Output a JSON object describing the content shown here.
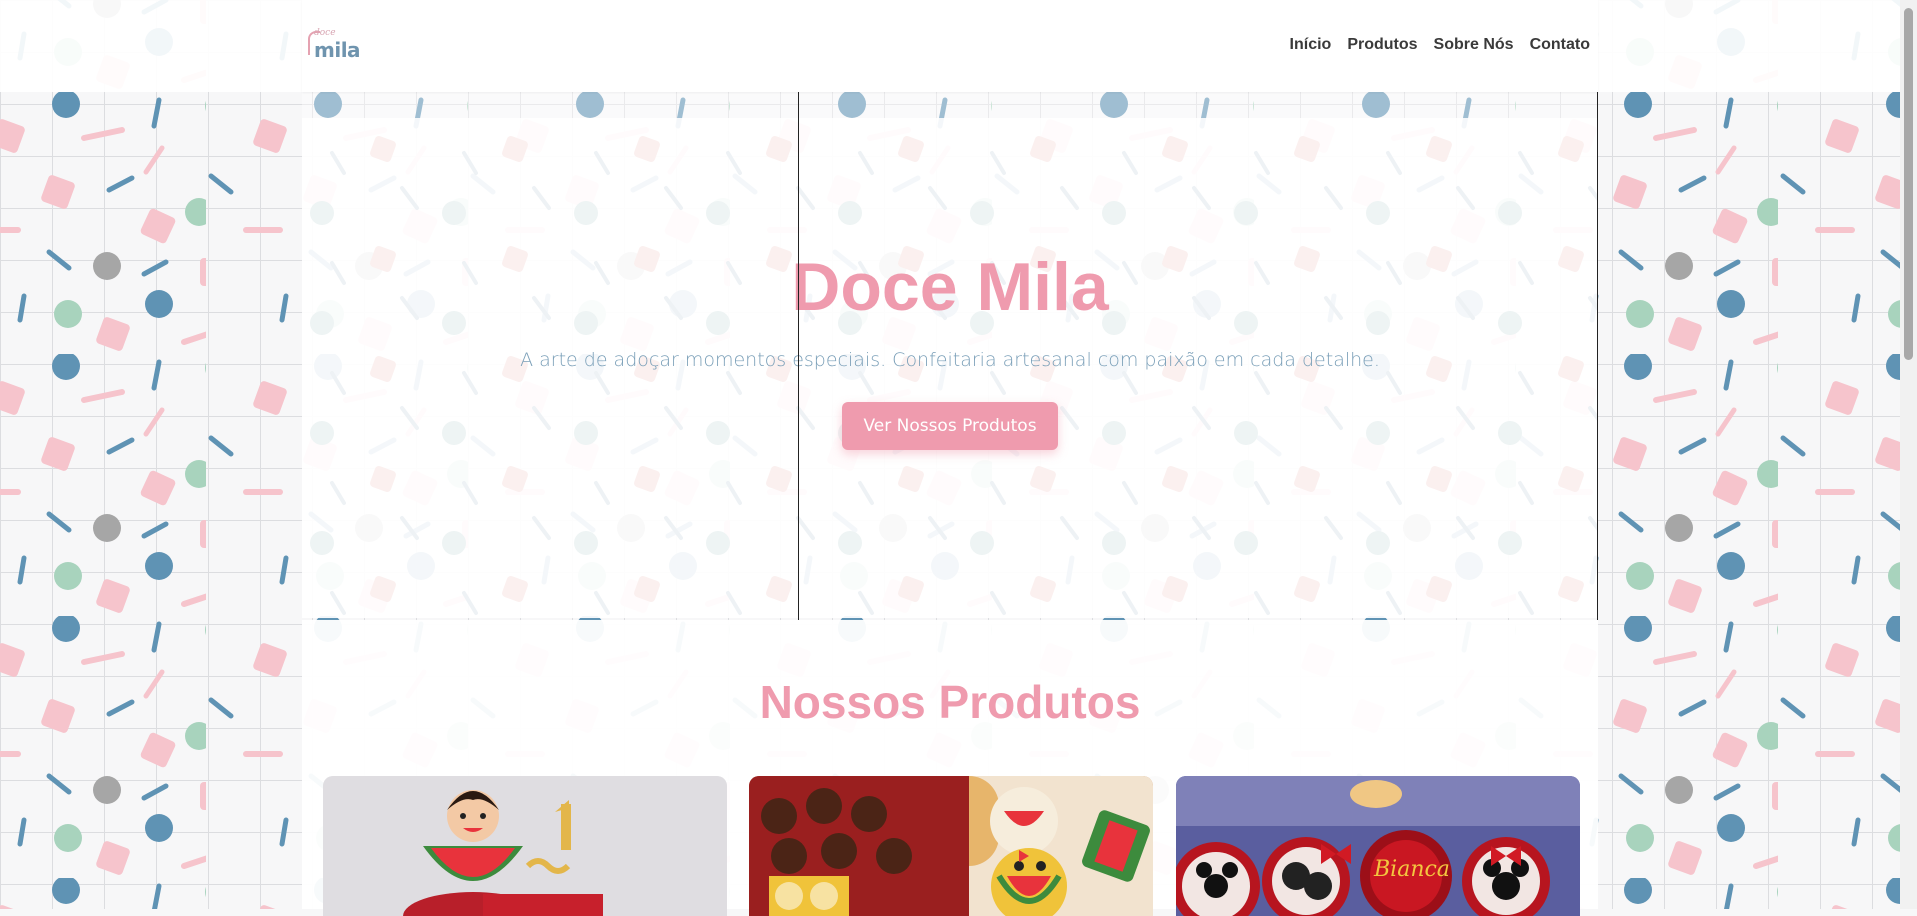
{
  "brand": {
    "logo_small": "doce",
    "logo_main": "mila"
  },
  "nav": {
    "items": [
      {
        "label": "Início"
      },
      {
        "label": "Produtos"
      },
      {
        "label": "Sobre Nós"
      },
      {
        "label": "Contato"
      }
    ]
  },
  "hero": {
    "title": "Doce Mila",
    "subtitle": "A arte de adoçar momentos especiais. Confeitaria artesanal com paixão em cada detalhe.",
    "cta_label": "Ver Nossos Produtos"
  },
  "products": {
    "title": "Nossos Produtos",
    "items": [
      {
        "image": "watermelon-baby-cake-photo"
      },
      {
        "image": "watermelon-cupcakes-photo"
      },
      {
        "image": "minnie-bianca-cupcakes-photo"
      }
    ]
  },
  "colors": {
    "accent_pink": "#ef9bae",
    "accent_blue": "#7a9fb8",
    "sprinkle_blue": "#5f93b4",
    "sprinkle_green": "#a8d3bd",
    "sprinkle_gray": "#a6a6a6",
    "sprinkle_pink": "#f6c4cc"
  }
}
